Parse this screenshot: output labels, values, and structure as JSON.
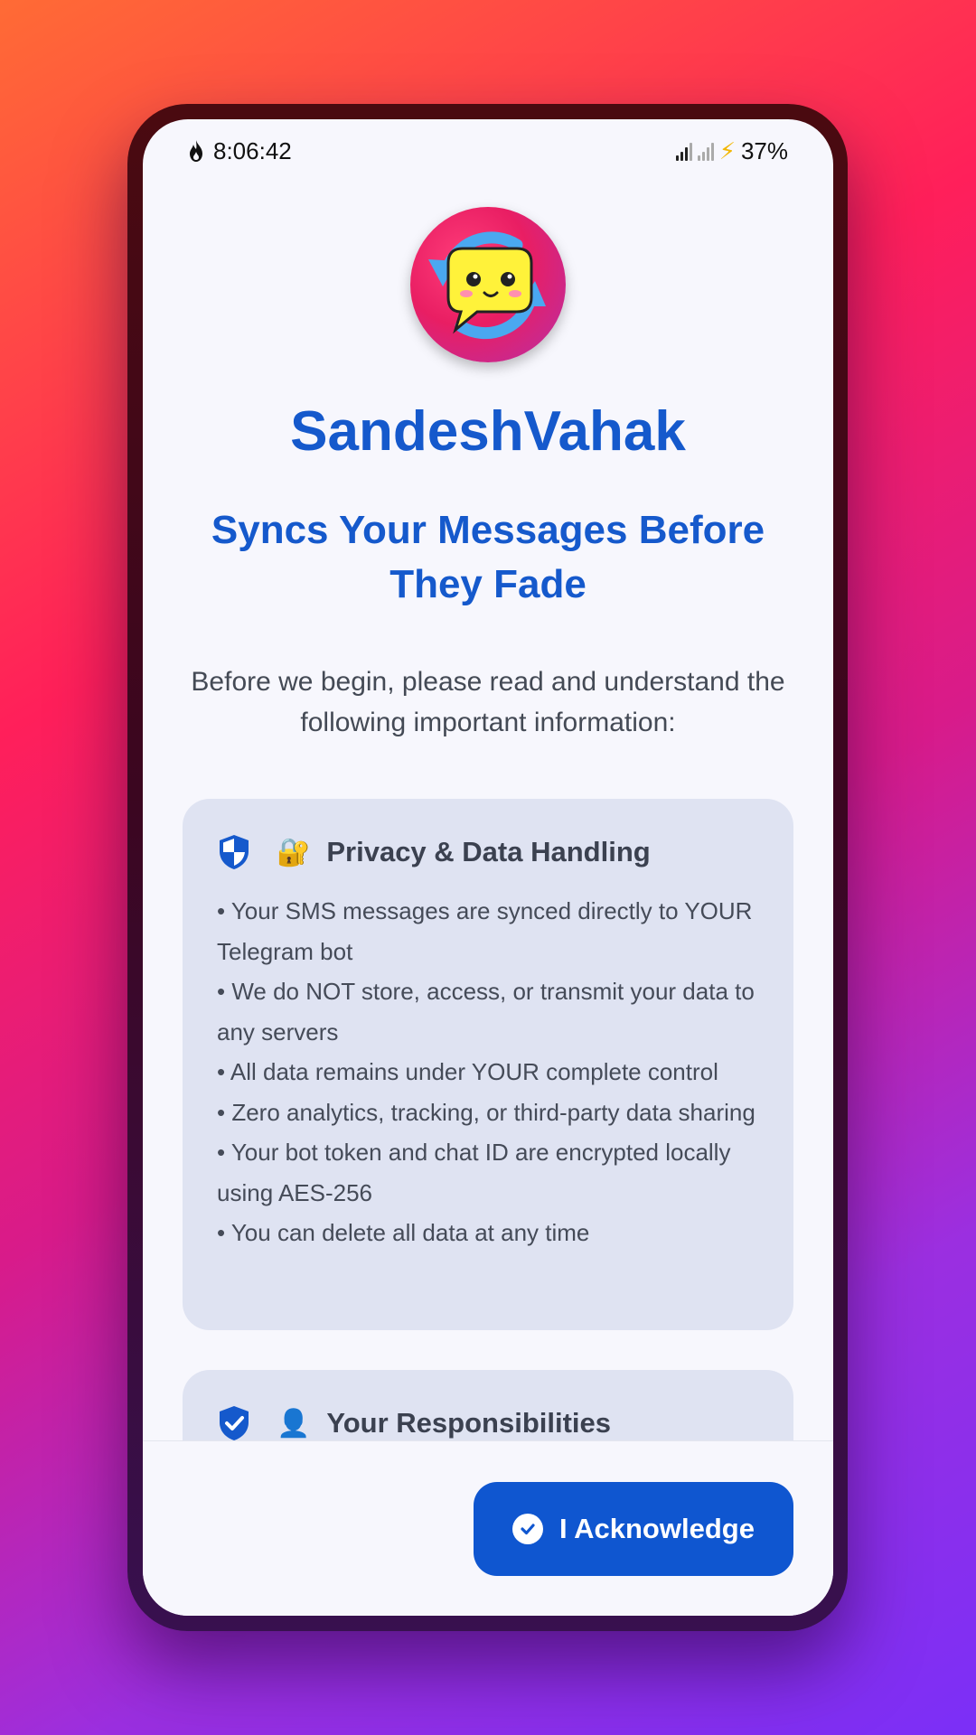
{
  "status_bar": {
    "time": "8:06:42",
    "battery": "37%"
  },
  "app": {
    "name": "SandeshVahak",
    "tagline": "Syncs Your Messages Before They Fade",
    "intro": "Before we begin, please read and understand the following important information:"
  },
  "privacy_card": {
    "emoji": "🔐",
    "title": "Privacy & Data Handling",
    "bullets": [
      "• Your SMS messages are synced directly to YOUR Telegram bot",
      "• We do NOT store, access, or transmit your data to any servers",
      "• All data remains under YOUR complete control",
      "• Zero analytics, tracking, or third-party data sharing",
      "• Your bot token and chat ID are encrypted locally using AES-256",
      "• You can delete all data at any time"
    ]
  },
  "responsibilities_card": {
    "emoji": "👤",
    "title": "Your Responsibilities"
  },
  "acknowledge_button": {
    "label": "I Acknowledge"
  },
  "colors": {
    "primary": "#1559cc",
    "card_bg": "#dfe3f2",
    "button_bg": "#0f56d0"
  }
}
